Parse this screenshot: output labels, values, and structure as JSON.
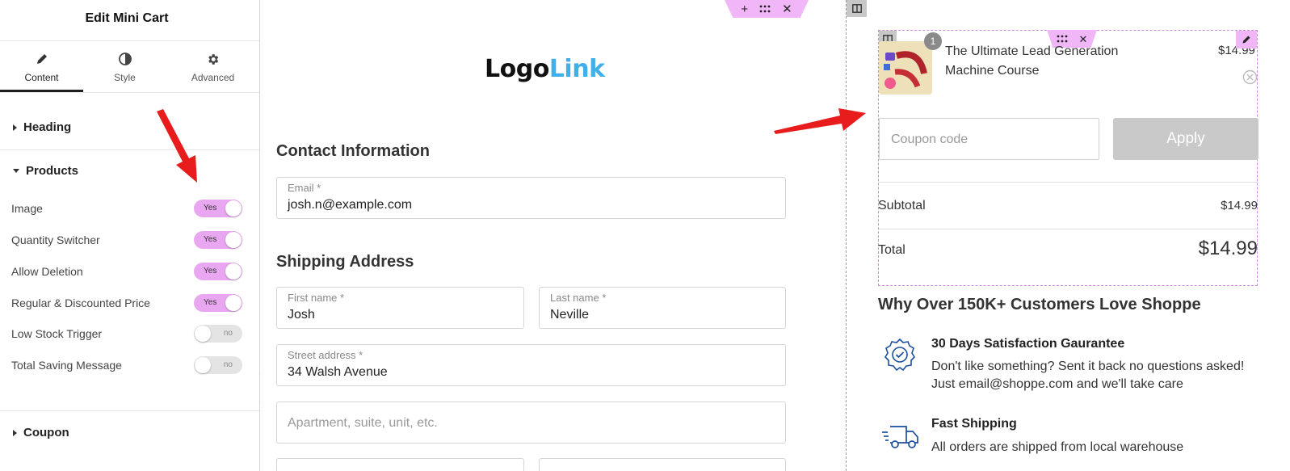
{
  "panel": {
    "title": "Edit Mini Cart",
    "tabs": [
      {
        "label": "Content",
        "icon": "pencil-icon",
        "active": true
      },
      {
        "label": "Style",
        "icon": "contrast-icon",
        "active": false
      },
      {
        "label": "Advanced",
        "icon": "gear-icon",
        "active": false
      }
    ],
    "sections": {
      "heading": "Heading",
      "products": "Products",
      "coupon": "Coupon"
    },
    "controls": [
      {
        "label": "Image",
        "state": "Yes",
        "on": true
      },
      {
        "label": "Quantity Switcher",
        "state": "Yes",
        "on": true
      },
      {
        "label": "Allow Deletion",
        "state": "Yes",
        "on": true
      },
      {
        "label": "Regular & Discounted Price",
        "state": "Yes",
        "on": true
      },
      {
        "label": "Low Stock Trigger",
        "state": "no",
        "on": false
      },
      {
        "label": "Total Saving Message",
        "state": "no",
        "on": false
      }
    ],
    "collapse_icon": "chevron-left-icon"
  },
  "canvas": {
    "toolbar_icons": [
      "plus-icon",
      "drag-handle-icon",
      "close-icon"
    ],
    "logo": {
      "part1": "Logo",
      "part2": "Link"
    },
    "contact": {
      "title": "Contact Information",
      "email": {
        "label": "Email *",
        "value": "josh.n@example.com"
      }
    },
    "shipping": {
      "title": "Shipping Address",
      "first_name": {
        "label": "First name *",
        "value": "Josh"
      },
      "last_name": {
        "label": "Last name *",
        "value": "Neville"
      },
      "street": {
        "label": "Street address *",
        "value": "34 Walsh Avenue"
      },
      "apartment": {
        "placeholder": "Apartment, suite, unit, etc."
      }
    }
  },
  "cart": {
    "item": {
      "quantity": "1",
      "name": "The Ultimate Lead Generation Machine Course",
      "price": "$14.99"
    },
    "coupon": {
      "placeholder": "Coupon code",
      "apply_label": "Apply"
    },
    "subtotal": {
      "label": "Subtotal",
      "value": "$14.99"
    },
    "total": {
      "label": "Total",
      "value": "$14.99"
    },
    "why": {
      "title": "Why Over 150K+ Customers Love Shoppe",
      "features": [
        {
          "icon": "badge-check-icon",
          "title": "30 Days Satisfaction Gaurantee",
          "lines": [
            "Don't like something? Sent it back no questions asked!",
            "Just email@shoppe.com and we'll take care"
          ]
        },
        {
          "icon": "delivery-truck-icon",
          "title": "Fast Shipping",
          "lines": [
            "All orders are shipped from local warehouse"
          ]
        }
      ]
    }
  },
  "colors": {
    "accent_pink": "#e8a7f0",
    "toolbar_pink": "#f0b6f7",
    "arrow_red": "#e81c1c",
    "logo_blue": "#3fb1e8",
    "icon_blue": "#1c4fa0"
  }
}
